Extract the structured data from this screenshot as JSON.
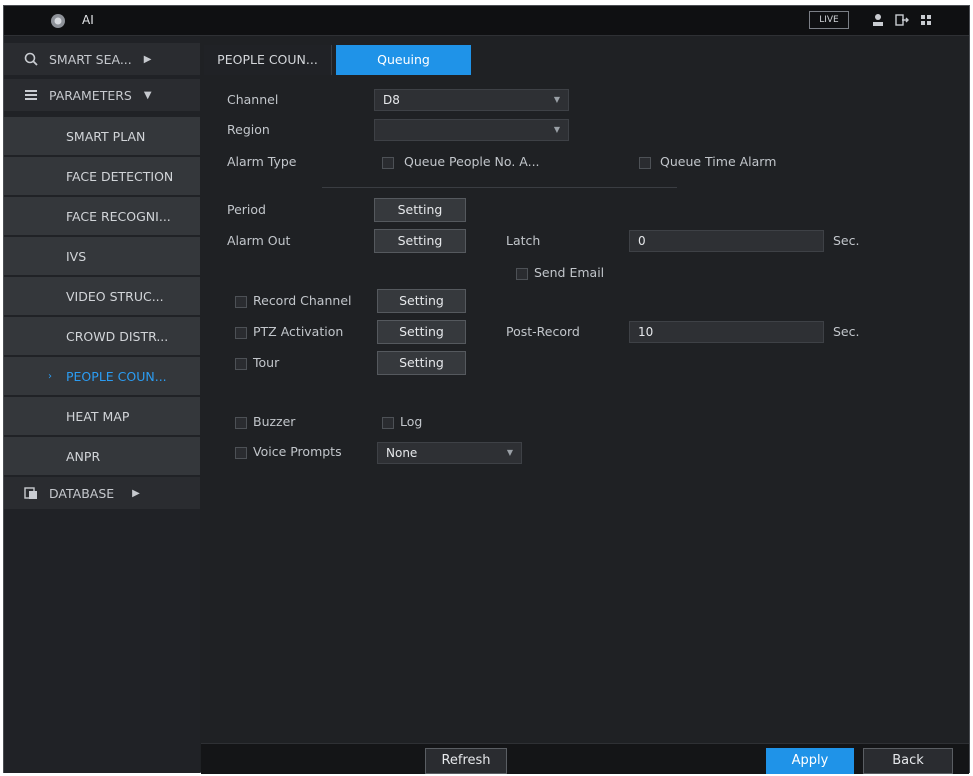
{
  "app": {
    "title": "AI",
    "live": "LIVE"
  },
  "sidebar": {
    "smart_search": "SMART SEA...",
    "parameters": "PARAMETERS",
    "database": "DATABASE",
    "items": [
      {
        "label": "SMART PLAN"
      },
      {
        "label": "FACE DETECTION"
      },
      {
        "label": "FACE RECOGNI..."
      },
      {
        "label": "IVS"
      },
      {
        "label": "VIDEO STRUC..."
      },
      {
        "label": "CROWD DISTR..."
      },
      {
        "label": "PEOPLE COUN..."
      },
      {
        "label": "HEAT MAP"
      },
      {
        "label": "ANPR"
      }
    ],
    "active_marker": "›"
  },
  "tabs": {
    "people_counting": "PEOPLE COUN...",
    "queuing": "Queuing"
  },
  "form": {
    "channel_label": "Channel",
    "channel_value": "D8",
    "region_label": "Region",
    "region_value": "",
    "alarm_type_label": "Alarm Type",
    "queue_people_alarm": "Queue People No. A...",
    "queue_time_alarm": "Queue Time Alarm",
    "period_label": "Period",
    "setting": "Setting",
    "alarm_out_label": "Alarm Out",
    "latch_label": "Latch",
    "latch_value": "0",
    "sec": "Sec.",
    "send_email": "Send Email",
    "record_channel": "Record Channel",
    "ptz_activation": "PTZ Activation",
    "post_record_label": "Post-Record",
    "post_record_value": "10",
    "tour": "Tour",
    "buzzer": "Buzzer",
    "log": "Log",
    "voice_prompts": "Voice Prompts",
    "voice_value": "None"
  },
  "buttons": {
    "refresh": "Refresh",
    "apply": "Apply",
    "back": "Back"
  },
  "colors": {
    "accent": "#1f93e8",
    "active_text": "#2b9cf2"
  }
}
